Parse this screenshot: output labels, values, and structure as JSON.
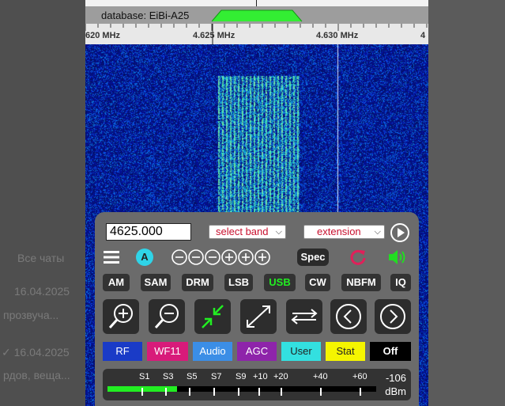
{
  "background_chat": {
    "all_chats": "Все чаты",
    "date1": "16.04.2025",
    "snippet1": "прозвуча...",
    "date2": "✓ 16.04.2025",
    "snippet2": "рдов, веща..."
  },
  "header": {
    "database_label": "database: EiBi-A25"
  },
  "scale": {
    "ticks": [
      "620 MHz",
      "4.625 MHz",
      "4.630 MHz",
      "4"
    ]
  },
  "controls": {
    "frequency_value": "4625.000",
    "band_select": "select band",
    "extension_select": "extension",
    "agc_mode_badge": "A",
    "spec_button": "Spec",
    "modes": [
      "AM",
      "SAM",
      "DRM",
      "LSB",
      "USB",
      "CW",
      "NBFM",
      "IQ"
    ],
    "active_mode": "USB",
    "color_buttons": [
      {
        "label": "RF",
        "bg": "#1a3bc7",
        "fg": "#ffffff"
      },
      {
        "label": "WF11",
        "bg": "#d81b7a",
        "fg": "#ffffff"
      },
      {
        "label": "Audio",
        "bg": "#3b8ee6",
        "fg": "#ffffff"
      },
      {
        "label": "AGC",
        "bg": "#8e24aa",
        "fg": "#ffffff"
      },
      {
        "label": "User",
        "bg": "#33e0e0",
        "fg": "#222222"
      },
      {
        "label": "Stat",
        "bg": "#f5f500",
        "fg": "#222222"
      },
      {
        "label": "Off",
        "bg": "#000000",
        "fg": "#ffffff"
      }
    ]
  },
  "smeter": {
    "labels": [
      "S1",
      "S3",
      "S5",
      "S7",
      "S9",
      "+10",
      "+20",
      "+40",
      "+60"
    ],
    "reading": "-106",
    "unit": "dBm",
    "level_fraction": 0.26
  },
  "colors": {
    "accent_green": "#22dd22",
    "reset_red": "#e0205a",
    "waterfall_bg": "#05105a"
  }
}
